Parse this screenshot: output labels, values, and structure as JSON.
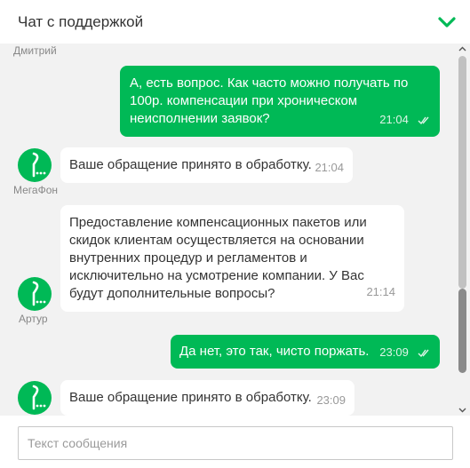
{
  "header": {
    "title": "Чат с поддержкой"
  },
  "messages": [
    {
      "sender": "Дмитрий"
    },
    {
      "text": "А, есть вопрос. Как часто можно получать по 100р. компенсации при хроническом неисполнении заявок?",
      "time": "21:04"
    },
    {
      "sender": "МегаФон",
      "text": "Ваше обращение принято в обработку.",
      "time": "21:04"
    },
    {
      "sender": "Артур",
      "text": "Предоставление компенсационных пакетов или скидок клиентам осуществляется на основании внутренних процедур и регламентов и исключительно на усмотрение компании. У Вас будут дополнительные вопросы?",
      "time": "21:14"
    },
    {
      "text": "Да нет, это так, чисто поржать.",
      "time": "23:09"
    },
    {
      "text": "Ваше обращение принято в обработку.",
      "time": "23:09"
    }
  ],
  "input": {
    "placeholder": "Текст сообщения",
    "value": ""
  },
  "colors": {
    "accent": "#00b956",
    "chat_background": "#f2f2f2",
    "incoming_bubble": "#ffffff"
  }
}
